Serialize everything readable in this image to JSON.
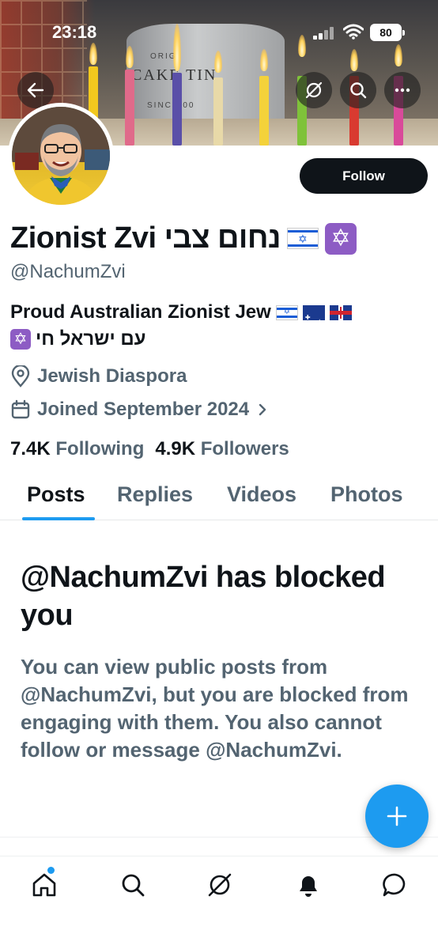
{
  "status_bar": {
    "time": "23:18",
    "battery": "80"
  },
  "banner": {
    "tin_origin": "ORIGI",
    "tin_label": "CAKE TIN",
    "tin_since": "SINCE 00"
  },
  "profile": {
    "name": "Zionist Zvi נחום צבי",
    "handle": "@NachumZvi",
    "bio_line1": "Proud Australian Zionist Jew",
    "bio_line2": "עם ישראל חי",
    "location": "Jewish Diaspora",
    "joined": "Joined September 2024",
    "following_count": "7.4K",
    "following_label": "Following",
    "followers_count": "4.9K",
    "followers_label": "Followers",
    "follow_button": "Follow"
  },
  "tabs": [
    {
      "label": "Posts",
      "active": true
    },
    {
      "label": "Replies",
      "active": false
    },
    {
      "label": "Videos",
      "active": false
    },
    {
      "label": "Photos",
      "active": false
    }
  ],
  "blocked": {
    "title": "@NachumZvi has blocked you",
    "message": "You can view public posts from @NachumZvi, but you are blocked from engaging with them. You also cannot follow or message @NachumZvi."
  },
  "icons": {
    "back": "arrow-left-icon",
    "grok": "grok-icon",
    "search": "search-icon",
    "more": "more-icon",
    "location": "location-pin-icon",
    "calendar": "calendar-icon",
    "chevron": "chevron-right-icon",
    "compose": "plus-icon",
    "nav": [
      "home-icon",
      "search-icon",
      "grok-icon",
      "bell-icon",
      "messages-icon"
    ]
  },
  "colors": {
    "accent": "#1d9bf0",
    "text": "#0f1419",
    "secondary": "#536471",
    "badge": "#8d5cc4"
  }
}
